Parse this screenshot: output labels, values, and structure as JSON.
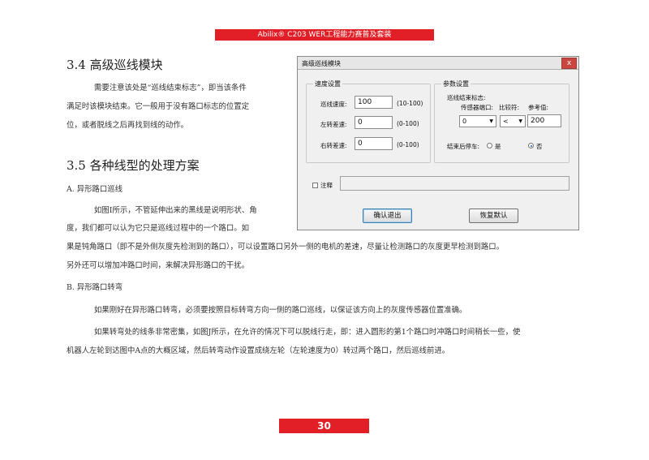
{
  "header": {
    "banner": "Abilix® C203 WER工程能力赛普及套装"
  },
  "sec34": {
    "title": "3.4 高级巡线模块",
    "lines": [
      "需要注意该处是“巡线结束标志”，即当该条件",
      "满足时该模块结束。它一般用于没有路口标志的位置定",
      "位，或者脱线之后再找到线的动作。"
    ]
  },
  "sec35": {
    "title": "3.5 各种线型的处理方案",
    "a_title": "A. 异形路口巡线",
    "a_lines": [
      "如图I所示，不管延伸出来的黑线是说明形状、角",
      "度，我们都可以认为它只是巡线过程中的一个路口。如",
      "果是钝角路口（即不是外侧灰度先检测到的路口），可以设置路口另外一侧的电机的差速，尽量让检测路口的灰度更早检测到路口。",
      "另外还可以增加冲路口时间，来解决异形路口的干扰。"
    ],
    "b_title": "B. 异形路口转弯",
    "b_lines": [
      "如果刚好在异形路口转弯，必须要按照目标转弯方向一侧的路口巡线，以保证该方向上的灰度传感器位置准确。",
      "如果转弯处的线条非常密集，如图J所示，在允许的情况下可以脱线行走，即：进入圆形的第1个路口时冲路口时间稍长一些，使",
      "机器人左轮到达图中A点的大概区域，然后转弯动作设置成绕左轮（左轮速度为0）转过两个路口，然后巡线前进。"
    ]
  },
  "dialog": {
    "title": "高级巡线模块",
    "close": "x",
    "speed_group": "速度设置",
    "speed_fields": [
      {
        "label": "巡线速度:",
        "value": "100",
        "range": "(10-100)"
      },
      {
        "label": "左转差速:",
        "value": "0",
        "range": "(0-100)"
      },
      {
        "label": "右转差速:",
        "value": "0",
        "range": "(0-100)"
      }
    ],
    "param_group": "参数设置",
    "end_flag_label": "巡线结束标志:",
    "sensor_port_label": "传感器端口:",
    "compare_label": "比较符:",
    "ref_label": "参考值:",
    "sensor_port_value": "0",
    "compare_value": "<",
    "ref_value": "200",
    "stop_label": "结束后停车:",
    "opt_yes": "是",
    "opt_no": "否",
    "stop_selected": "否",
    "comment_label": "注释",
    "comment_value": "",
    "confirm_button": "确认退出",
    "reset_button": "恢复默认"
  },
  "footer": {
    "page_number": "30"
  }
}
